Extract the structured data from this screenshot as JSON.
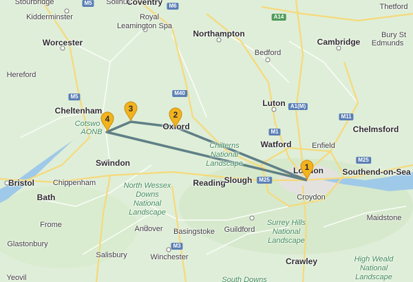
{
  "places": {
    "stourbridge": "Stourbridge",
    "solihull": "Solihull",
    "coventry": "Coventry",
    "kidderminster": "Kidderminster",
    "royal_leamington_spa_1": "Royal",
    "royal_leamington_spa_2": "Leamington Spa",
    "thetford": "Thetford",
    "worcester": "Worcester",
    "northampton": "Northampton",
    "cambridge": "Cambridge",
    "bury_st_edmunds_1": "Bury St",
    "bury_st_edmunds_2": "Edmunds",
    "bedford": "Bedford",
    "hereford": "Hereford",
    "cheltenham": "Cheltenham",
    "luton": "Luton",
    "oxford": "Oxford",
    "chelmsford": "Chelmsford",
    "watford": "Watford",
    "enfield": "Enfield",
    "swindon": "Swindon",
    "london": "London",
    "southend": "Southend-on-Sea",
    "bristol": "Bristol",
    "chippenham": "Chippenham",
    "reading": "Reading",
    "slough": "Slough",
    "bath": "Bath",
    "croydon": "Croydon",
    "frome": "Frome",
    "andover": "Andover",
    "basingstoke": "Basingstoke",
    "guildford": "Guildford",
    "maidstone": "Maidstone",
    "glastonbury": "Glastonbury",
    "salisbury": "Salisbury",
    "winchester": "Winchester",
    "crawley": "Crawley",
    "yeovil": "Yeovil"
  },
  "green_areas": {
    "cotswolds_1": "Cotswo",
    "cotswolds_2": "AONB",
    "chilterns_1": "Chilterns",
    "chilterns_2": "National",
    "chilterns_3": "Landscape",
    "north_wessex_1": "North Wessex",
    "north_wessex_2": "Downs",
    "north_wessex_3": "National",
    "north_wessex_4": "Landscape",
    "surrey_1": "Surrey Hills",
    "surrey_2": "National",
    "surrey_3": "Landscape",
    "high_weald_1": "High Weald",
    "high_weald_2": "National",
    "high_weald_3": "Landscape",
    "south_downs": "South Downs"
  },
  "roads": {
    "m5": "M5",
    "m6": "M6",
    "m40": "M40",
    "m1": "M1",
    "a1m": "A1(M)",
    "m11": "M11",
    "m25_a": "M25",
    "m25_b": "M25",
    "m3": "M3",
    "a14": "A14"
  },
  "markers": [
    "1",
    "2",
    "3",
    "4"
  ],
  "colors": {
    "land": "#dfeed8",
    "water": "#9fc9e8",
    "route": "#5f7f86",
    "marker": "#f2b31f",
    "motorway_shield": "#5b7fb6"
  }
}
